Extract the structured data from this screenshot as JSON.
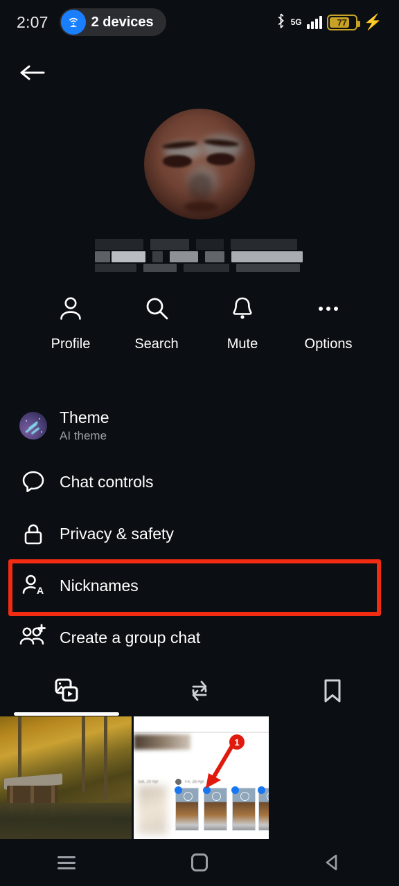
{
  "status_bar": {
    "clock": "2:07",
    "hotspot_label": "2 devices",
    "hotspot_icon": "wifi-hotspot-icon",
    "bluetooth_icon": "bluetooth-icon",
    "network_label": "5G",
    "signal_icon": "signal-bars-icon",
    "battery_level": "77",
    "battery_icon": "battery-icon",
    "charging_icon": "charging-bolt-icon",
    "accent_blue": "#1a7fff",
    "battery_gold": "#c8a227"
  },
  "header": {
    "back_icon": "back-arrow-icon",
    "avatar": "profile-avatar",
    "name_redacted": true
  },
  "actions": [
    {
      "label": "Profile",
      "icon": "person-icon"
    },
    {
      "label": "Search",
      "icon": "search-icon"
    },
    {
      "label": "Mute",
      "icon": "bell-icon"
    },
    {
      "label": "Options",
      "icon": "more-horizontal-icon"
    }
  ],
  "menu": [
    {
      "title": "Theme",
      "subtitle": "AI theme",
      "icon": "theme-orb-icon"
    },
    {
      "title": "Chat controls",
      "subtitle": "",
      "icon": "chat-bubble-icon"
    },
    {
      "title": "Privacy & safety",
      "subtitle": "",
      "icon": "lock-icon"
    },
    {
      "title": "Nicknames",
      "subtitle": "",
      "icon": "person-letter-a-icon"
    },
    {
      "title": "Create a group chat",
      "subtitle": "",
      "icon": "person-add-icon"
    }
  ],
  "highlight": {
    "target": "Nicknames",
    "color": "#f22c12"
  },
  "tabs": [
    {
      "icon": "media-photo-video-icon",
      "active": true
    },
    {
      "icon": "repeat-loop-icon",
      "active": false
    },
    {
      "icon": "bookmark-icon",
      "active": false
    }
  ],
  "media": [
    {
      "name": "autumn-lake-cabin-photo"
    },
    {
      "name": "annotated-screenshot-photo",
      "annotation_number": "1"
    }
  ],
  "navbar": [
    {
      "icon": "recents-menu-icon"
    },
    {
      "icon": "home-square-icon"
    },
    {
      "icon": "back-triangle-icon"
    }
  ]
}
